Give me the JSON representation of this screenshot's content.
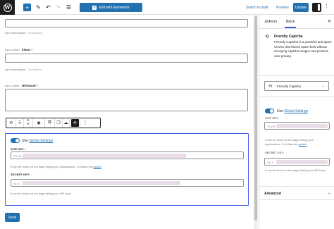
{
  "toolbar": {
    "add_icon": "plus-icon",
    "elementor_label": "Edit with Elementor",
    "switch_draft": "Switch to draft",
    "preview": "Preview",
    "update": "Update"
  },
  "form": {
    "top_desc_label": "Input description:",
    "top_desc_hint": "Description...",
    "email": {
      "label_prefix": "Input Label:",
      "label": "EMAIL *",
      "desc_label": "Input description:",
      "desc_hint": "Description..."
    },
    "message": {
      "label_prefix": "Input Label:",
      "label": "MESSAGE *"
    },
    "send_label": "Send"
  },
  "captcha_block": {
    "toggle_text": "Use",
    "toggle_link": "Global Settings",
    "site_key_label": "SITE KEY:",
    "site_key_placeholder": "YOUR",
    "site_key_help_prefix": "It can be found on the page listing your Applications. Or follow this",
    "site_key_help_link": "guide!",
    "secret_key_label": "SECRET KEY:",
    "secret_key_placeholder": "A1U7",
    "secret_key_help": "It can be found on the page listing your API keys."
  },
  "sidebar": {
    "tabs": [
      "JetForm",
      "Block"
    ],
    "active_tab": "Block",
    "block_title": "Friendly Captcha",
    "block_desc": "Friendly Captcha is a powerful anti-spam service that blocks spam-bots without annoying captcha images and protects user privacy.",
    "select_value": "Friendly Captcha",
    "toggle_text": "Use",
    "toggle_link": "Global Settings",
    "site_key_label": "SITE KEY:",
    "site_key_placeholder": "YOUR",
    "site_key_help_prefix": "It can be found on the page listing your Applications. Or follow this",
    "site_key_help_link": "guide!",
    "secret_key_label": "SECRET KEY:",
    "secret_key_placeholder": "A1U7",
    "secret_key_help": "It can be found on the page listing your API keys.",
    "advanced_label": "Advanced"
  },
  "colors": {
    "accent": "#2271b1",
    "selection": "#3858e9",
    "dark": "#1e1e1e"
  }
}
